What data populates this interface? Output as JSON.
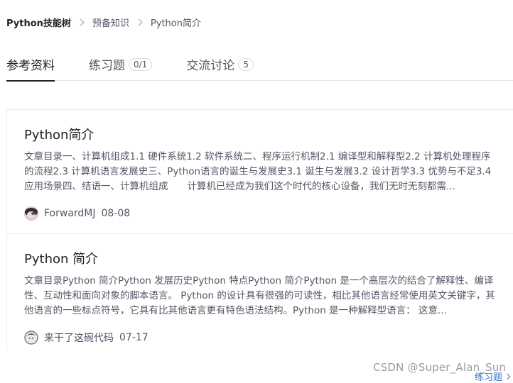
{
  "breadcrumb": {
    "items": [
      "Python技能树",
      "预备知识",
      "Python简介"
    ]
  },
  "tabs": [
    {
      "label": "参考资料",
      "badge": ""
    },
    {
      "label": "练习题",
      "badge": "0/1"
    },
    {
      "label": "交流讨论",
      "badge": "5"
    }
  ],
  "cards": [
    {
      "title": "Python简介",
      "summary": "文章目录一、计算机组成1.1 硬件系统1.2 软件系统二、程序运行机制2.1 编译型和解释型2.2 计算机处理程序的流程2.3 计算机语言发展史三、Python语言的诞生与发展史3.1 诞生与发展3.2 设计哲学3.3 优势与不足3.4 应用场景四、结语一、计算机组成　　计算机已经成为我们这个时代的核心设备，我们无时无刻都需...",
      "author": "ForwardMJ",
      "date": "08-08"
    },
    {
      "title": "Python 简介",
      "summary": "文章目录Python 简介Python 发展历史Python 特点Python 简介Python 是一个高层次的结合了解释性、编译性、互动性和面向对象的脚本语言。 Python 的设计具有很强的可读性，相比其他语言经常使用英文关键字，其他语言的一些标点符号，它具有比其他语言更有特色语法结构。Python 是一种解释型语言： 这意...",
      "author": "来干了这碗代码",
      "date": "07-17"
    }
  ],
  "footer": {
    "watermark": "CSDN @Super_Alan_Sun",
    "next_link": "练习题"
  },
  "colors": {
    "text_primary": "#222226",
    "text_secondary": "#555666",
    "link": "#3a73c6"
  }
}
